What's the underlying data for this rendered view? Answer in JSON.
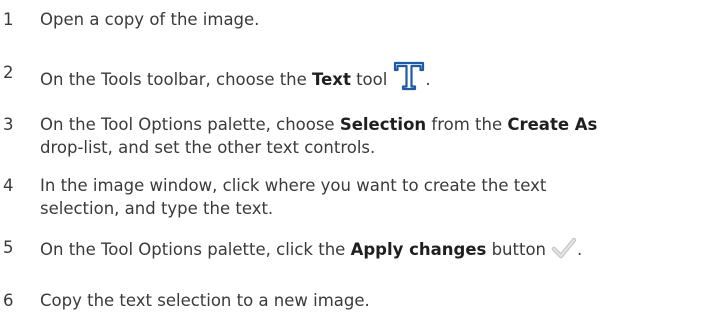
{
  "steps": [
    {
      "num": "1",
      "text": "Open a copy of the image."
    },
    {
      "num": "2",
      "pre": "On the Tools toolbar, choose the ",
      "bold": "Text",
      "post": " tool",
      "icon": "text-tool-icon",
      "after_icon": "."
    },
    {
      "num": "3",
      "pre": "On the Tool Options palette, choose ",
      "bold1": "Selection",
      "mid": " from the ",
      "bold2": "Create As",
      "line2": "drop-list, and set the other text controls."
    },
    {
      "num": "4",
      "line1": "In the image window, click where you want to create the text",
      "line2": "selection, and type the text."
    },
    {
      "num": "5",
      "pre": "On the Tool Options palette, click the ",
      "bold": "Apply changes",
      "post": " button",
      "icon": "apply-checkmark-icon",
      "after_icon": "."
    },
    {
      "num": "6",
      "text": "Copy the text selection to a new image."
    }
  ],
  "colors": {
    "text": "#3a3a3a",
    "bold": "#1f1f1f",
    "icon_blue": "#1e5aa8",
    "check_gray": "#c8c8c8"
  }
}
